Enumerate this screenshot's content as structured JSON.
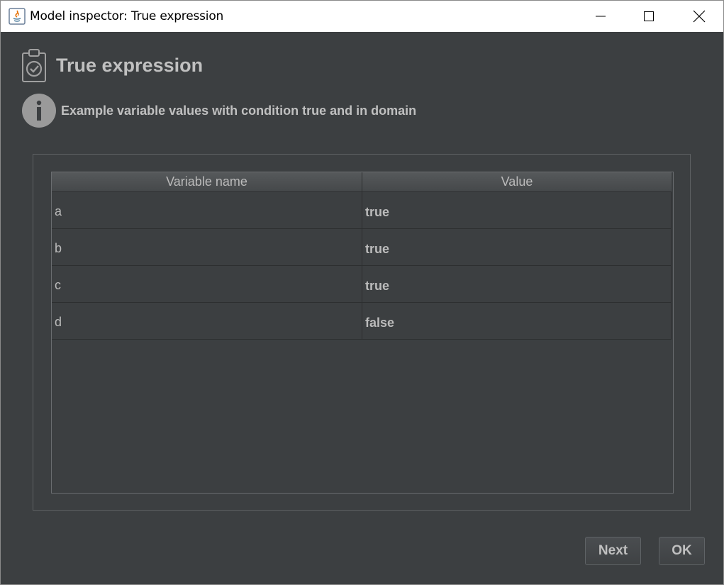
{
  "window": {
    "title": "Model inspector: True expression",
    "controls": {
      "minimize_icon": "minimize-icon",
      "maximize_icon": "maximize-icon",
      "close_icon": "close-icon"
    }
  },
  "header": {
    "title": "True expression",
    "icon": "clipboard-check-icon"
  },
  "info": {
    "icon": "info-icon",
    "message": "Example variable values with condition true and in domain"
  },
  "table": {
    "columns": [
      "Variable name",
      "Value"
    ],
    "rows": [
      {
        "name": "a",
        "value": "true"
      },
      {
        "name": "b",
        "value": "true"
      },
      {
        "name": "c",
        "value": "true"
      },
      {
        "name": "d",
        "value": "false"
      }
    ]
  },
  "buttons": {
    "next": "Next",
    "ok": "OK"
  },
  "colors": {
    "background": "#3c3f41",
    "text": "#bbbbbb",
    "titlebar": "#ffffff"
  }
}
